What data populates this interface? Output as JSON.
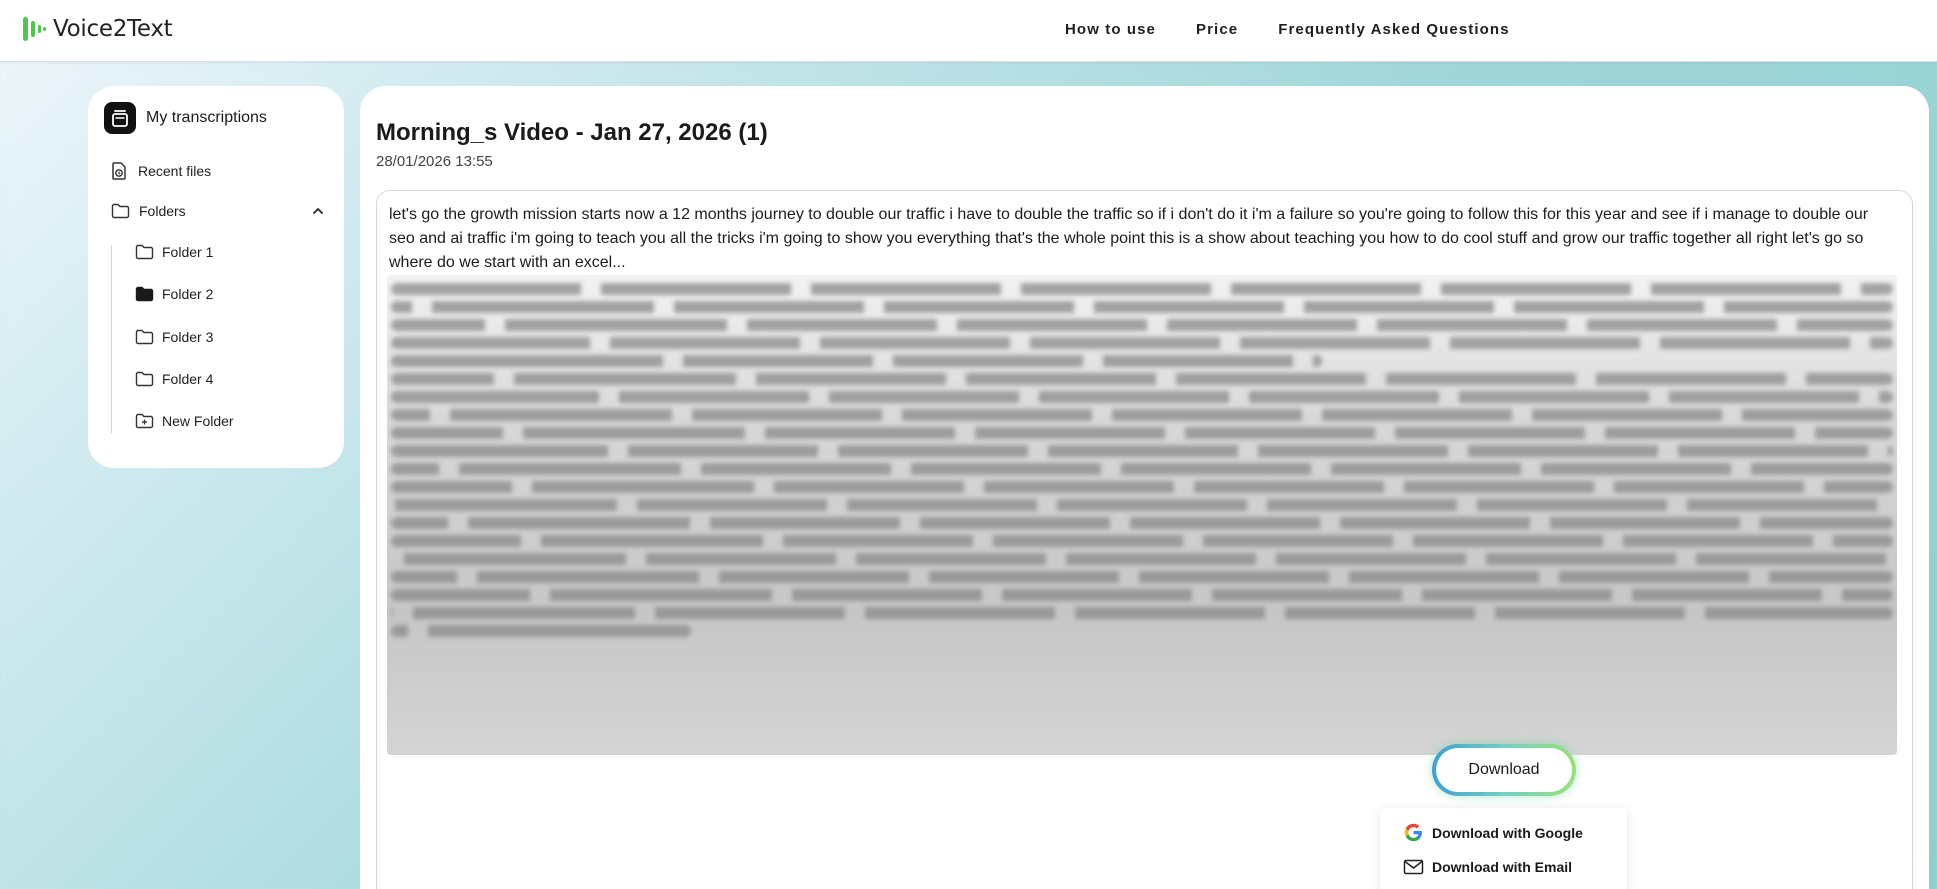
{
  "brand": {
    "name": "Voice2Text"
  },
  "nav": {
    "items": [
      {
        "label": "How to use"
      },
      {
        "label": "Price"
      },
      {
        "label": "Frequently Asked Questions"
      }
    ]
  },
  "sidebar": {
    "title": "My transcriptions",
    "recent_label": "Recent files",
    "folders_label": "Folders",
    "folders_expanded": true,
    "folders": [
      {
        "label": "Folder 1",
        "icon": "folder-outline-icon"
      },
      {
        "label": "Folder 2",
        "icon": "folder-filled-icon",
        "selected": true
      },
      {
        "label": "Folder 3",
        "icon": "folder-outline-icon"
      },
      {
        "label": "Folder 4",
        "icon": "folder-outline-icon"
      }
    ],
    "new_folder_label": "New Folder"
  },
  "document": {
    "title": "Morning_s Video - Jan 27, 2026 (1)",
    "date": "28/01/2026 13:55",
    "preview_text": "let's go the growth mission starts now a 12 months journey to double our traffic i have to double the traffic so if i don't do it i'm a failure so you're going to follow this for this year and see if i manage to double our seo and ai traffic i'm going to teach you all the tricks i'm going to show you everything that's the whole point this is a show about teaching you how to do cool stuff and grow our traffic together all right let's go so where do we start with an excel..."
  },
  "download": {
    "button_label": "Download",
    "options": [
      {
        "label": "Download with Google",
        "icon": "google-icon"
      },
      {
        "label": "Download with Email",
        "icon": "mail-icon"
      }
    ]
  },
  "colors": {
    "brand_green": "#4cc94c",
    "accent_gradient_start": "#3aa0d8",
    "accent_gradient_end": "#9be07a"
  }
}
